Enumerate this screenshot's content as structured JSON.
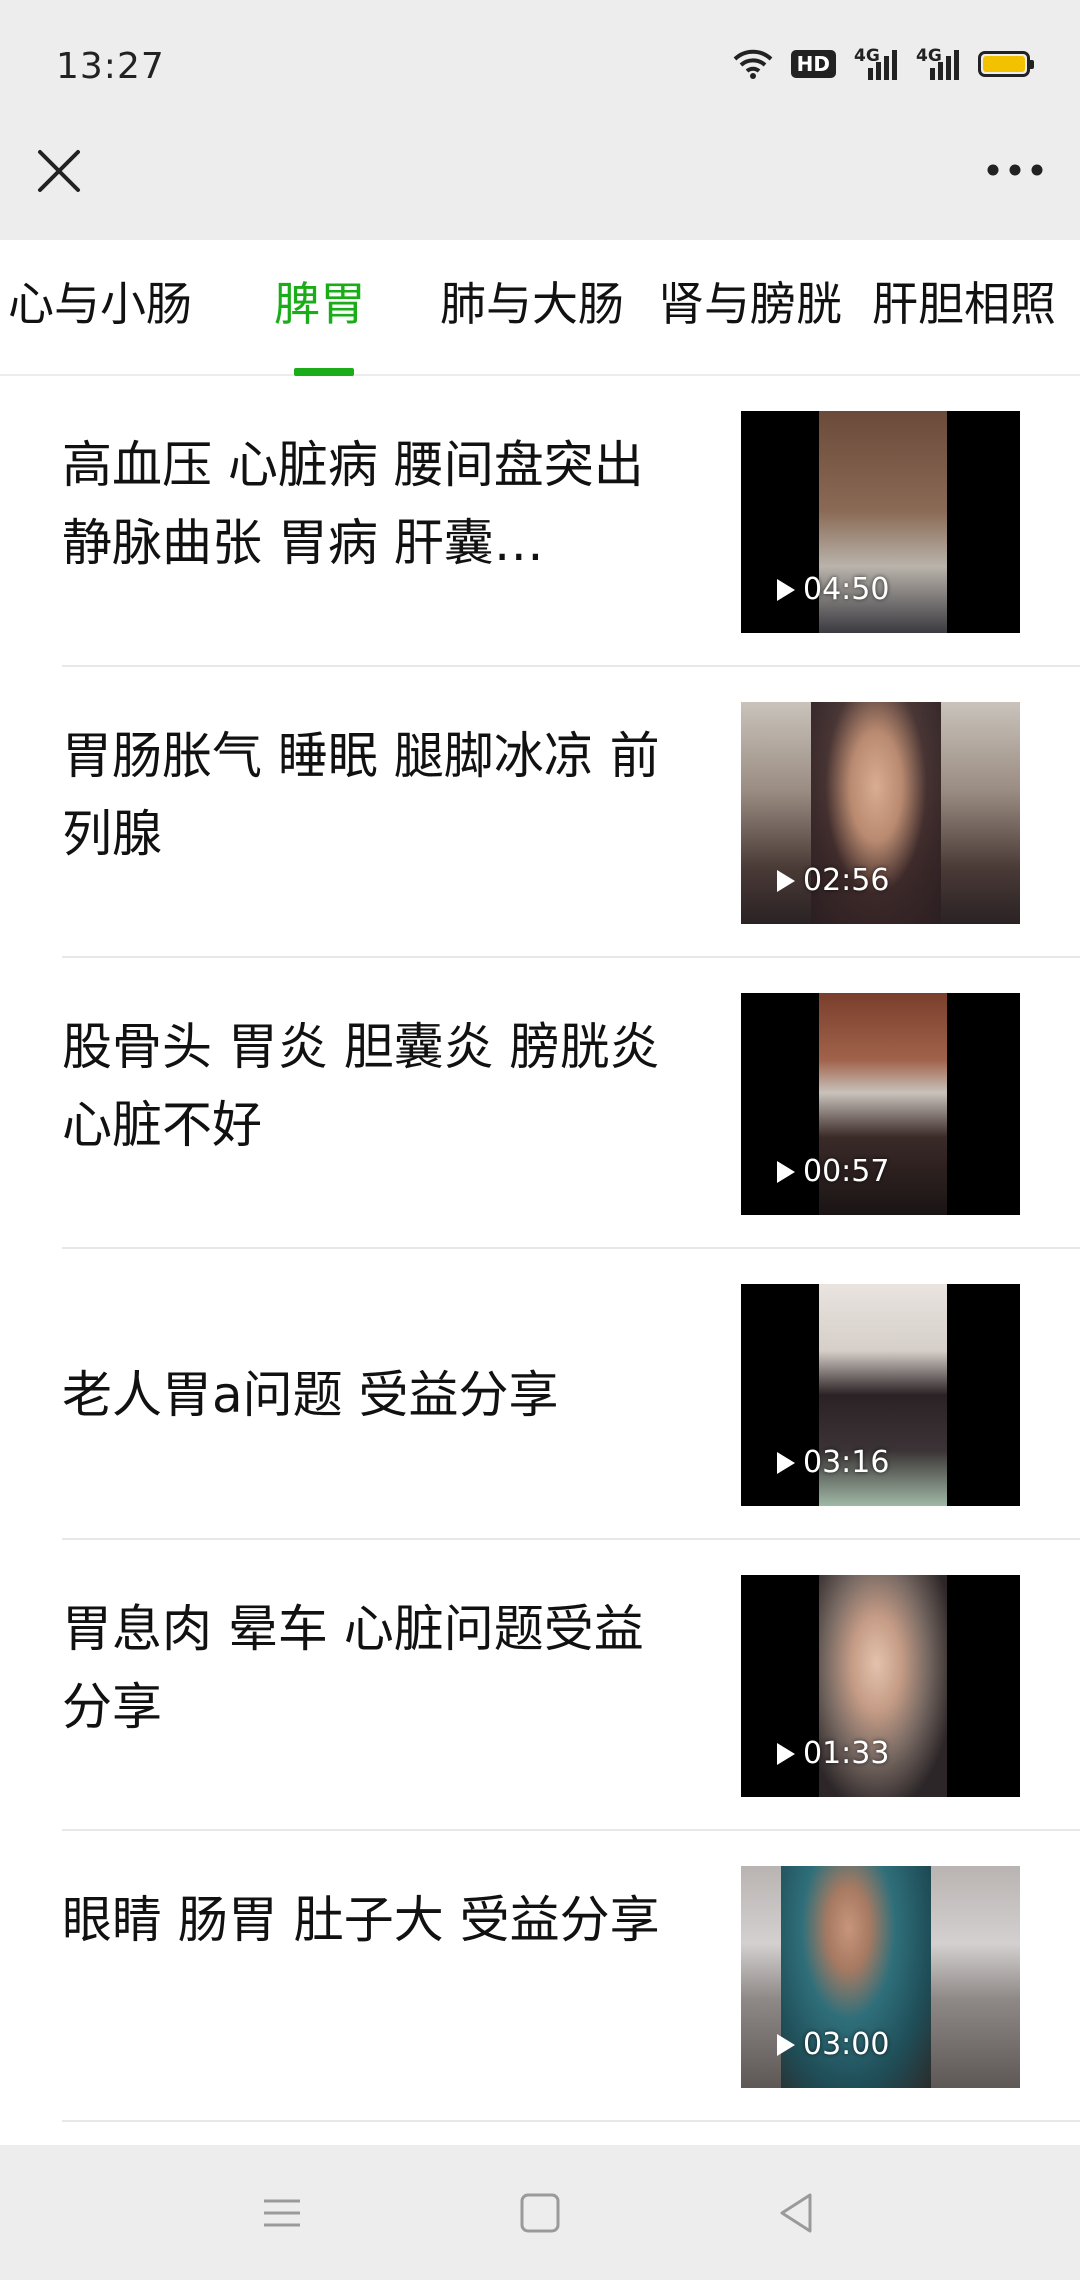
{
  "status_bar": {
    "time": "13:27",
    "hd_label": "HD",
    "network_1": "4G",
    "network_2": "4G",
    "battery_color": "#f2c200",
    "icons": [
      "wifi-icon",
      "hd-icon",
      "signal-icon",
      "signal-icon",
      "battery-icon"
    ]
  },
  "titlebar": {
    "close_icon": "close-icon",
    "more_icon": "more-icon"
  },
  "tabs": [
    {
      "label": "心与小肠",
      "active": false
    },
    {
      "label": "脾胃",
      "active": true
    },
    {
      "label": "肺与大肠",
      "active": false
    },
    {
      "label": "肾与膀胱",
      "active": false
    },
    {
      "label": "肝胆相照",
      "active": false
    }
  ],
  "accent_color": "#1aad19",
  "videos": [
    {
      "title": "高血压 心脏病 腰间盘突出 静脉曲张 胃病 肝囊…",
      "duration": "04:50"
    },
    {
      "title": "胃肠胀气 睡眠 腿脚冰凉 前列腺",
      "duration": "02:56"
    },
    {
      "title": "股骨头 胃炎 胆囊炎 膀胱炎 心脏不好",
      "duration": "00:57"
    },
    {
      "title": "老人胃a问题 受益分享",
      "duration": "03:16"
    },
    {
      "title": "胃息肉 晕车 心脏问题受益分享",
      "duration": "01:33"
    },
    {
      "title": "眼睛 肠胃 肚子大 受益分享",
      "duration": "03:00"
    }
  ],
  "navbar": {
    "menu_icon": "menu-icon",
    "home_icon": "home-icon",
    "back_icon": "back-icon"
  }
}
